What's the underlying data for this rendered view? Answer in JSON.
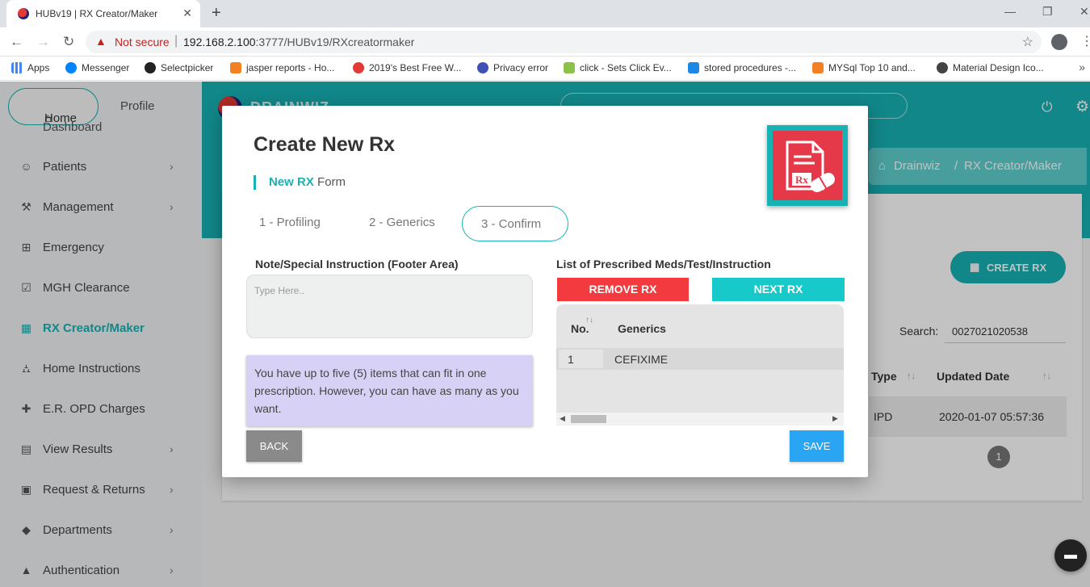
{
  "browser": {
    "tab_title": "HUBv19 | RX Creator/Maker",
    "not_secure": "Not secure",
    "url_host": "192.168.2.100",
    "url_path": ":3777/HUBv19/RXcreatormaker",
    "bookmarks": [
      {
        "label": "Apps",
        "color": "#4285f4"
      },
      {
        "label": "Messenger",
        "color": "#0084ff"
      },
      {
        "label": "Selectpicker",
        "color": "#222222"
      },
      {
        "label": "jasper reports - Ho...",
        "color": "#f48024"
      },
      {
        "label": "2019's Best Free W...",
        "color": "#e53935"
      },
      {
        "label": "Privacy error",
        "color": "#3f51b5"
      },
      {
        "label": "click - Sets Click Ev...",
        "color": "#8bc34a"
      },
      {
        "label": "stored procedures -...",
        "color": "#1e88e5"
      },
      {
        "label": "MYSql Top 10 and...",
        "color": "#f48024"
      },
      {
        "label": "Material Design Ico...",
        "color": "#444444"
      }
    ]
  },
  "sidebar": {
    "home_tab": "Home",
    "profile_tab": "Profile",
    "dashboard_cut": "Dashboard",
    "items": [
      {
        "label": "Patients",
        "icon": "patient-icon",
        "chevron": true
      },
      {
        "label": "Management",
        "icon": "wrench-icon",
        "chevron": true
      },
      {
        "label": "Emergency",
        "icon": "plus-square-icon",
        "chevron": false
      },
      {
        "label": "MGH Clearance",
        "icon": "check-square-icon",
        "chevron": false
      },
      {
        "label": "RX Creator/Maker",
        "icon": "grid-icon",
        "chevron": false,
        "active": true
      },
      {
        "label": "Home Instructions",
        "icon": "bed-icon",
        "chevron": false
      },
      {
        "label": "E.R. OPD Charges",
        "icon": "ambulance-icon",
        "chevron": false
      },
      {
        "label": "View Results",
        "icon": "clipboard-icon",
        "chevron": true
      },
      {
        "label": "Request & Returns",
        "icon": "return-icon",
        "chevron": true
      },
      {
        "label": "Departments",
        "icon": "tag-icon",
        "chevron": true
      },
      {
        "label": "Authentication",
        "icon": "lock-icon",
        "chevron": true
      }
    ]
  },
  "header": {
    "brand": "DRAINWIZ",
    "breadcrumb_root": "Drainwiz",
    "breadcrumb_sep": "/",
    "breadcrumb_page": "RX Creator/Maker"
  },
  "background_page": {
    "create_rx": "CREATE RX",
    "search_label": "Search:",
    "search_value": "0027021020538",
    "col_type": "Type",
    "col_updated": "Updated Date",
    "row_type": "IPD",
    "row_updated": "2020-01-07 05:57:36",
    "page_number": "1"
  },
  "modal": {
    "title": "Create New Rx",
    "subtitle_highlight": "New RX",
    "subtitle_rest": " Form",
    "badge_text": "Rx",
    "steps": [
      "1 - Profiling",
      "2 - Generics",
      "3 - Confirm"
    ],
    "active_step": 3,
    "note_label": "Note/Special Instruction (Footer Area)",
    "note_placeholder": "Type Here..",
    "note_value": "",
    "info_text": "You have up to five (5) items that can fit in one prescription. However, you can have as many as you want.",
    "back_label": "BACK",
    "list_label": "List of Prescribed Meds/Test/Instruction",
    "remove_label": "REMOVE RX",
    "next_label": "NEXT RX",
    "table_headers": {
      "no": "No.",
      "generics": "Generics"
    },
    "rows": [
      {
        "no": "1",
        "generics": "CEFIXIME"
      }
    ],
    "save_label": "SAVE"
  },
  "colors": {
    "accent": "#17b2b4",
    "remove": "#f23a3f",
    "next": "#17c9c9",
    "save": "#2aa5f3",
    "info_bg": "#d7d1f5",
    "badge_red": "#e5394a"
  }
}
